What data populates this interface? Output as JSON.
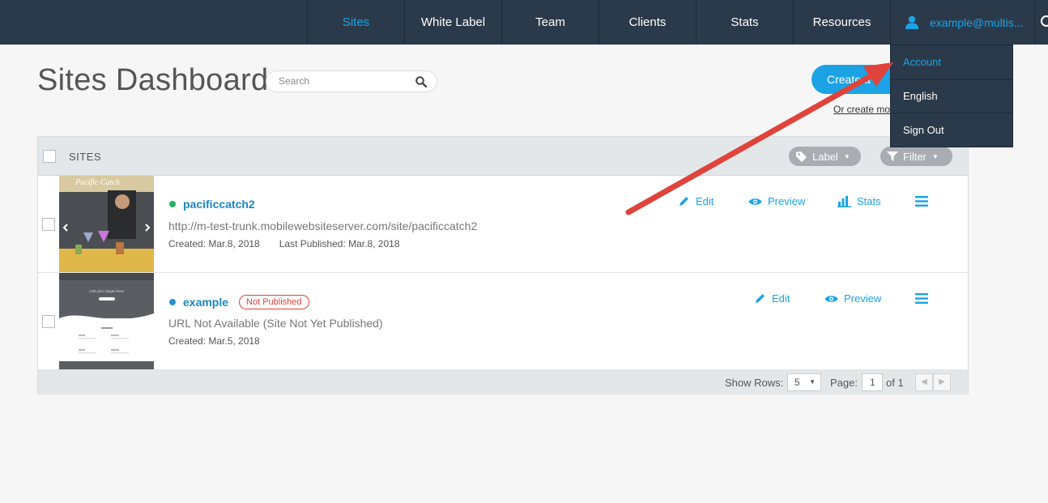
{
  "nav": {
    "items": [
      {
        "label": "Sites",
        "active": true
      },
      {
        "label": "White Label"
      },
      {
        "label": "Team"
      },
      {
        "label": "Clients"
      },
      {
        "label": "Stats"
      },
      {
        "label": "Resources"
      }
    ],
    "user": "example@multis..."
  },
  "dropdown": {
    "items": [
      "Account",
      "English",
      "Sign Out"
    ]
  },
  "page": {
    "title": "Sites Dashboard",
    "search_placeholder": "Search",
    "create_button": "Create a",
    "create_link": "Or create mo"
  },
  "table": {
    "header": "SITES",
    "label_button": "Label",
    "filter_button": "Filter",
    "sites": [
      {
        "name": "pacificcatch2",
        "status_color": "#27ae60",
        "url": "http://m-test-trunk.mobilewebsiteserver.com/site/pacificcatch2",
        "created": "Created: Mar.8, 2018",
        "published": "Last Published: Mar.8, 2018",
        "thumb_text": "Pacific Catch",
        "actions": {
          "edit": "Edit",
          "preview": "Preview",
          "stats": "Stats"
        }
      },
      {
        "name": "example",
        "status_color": "#2b8fd0",
        "badge": "Not Published",
        "url": "URL Not Available (Site Not Yet Published)",
        "created": "Created: Mar.5, 2018",
        "thumb_text": "Add your slogan here",
        "actions": {
          "edit": "Edit",
          "preview": "Preview"
        }
      }
    ],
    "footer": {
      "show_rows_label": "Show Rows:",
      "rows_value": "5",
      "page_label": "Page:",
      "page_value": "1",
      "of_label": "of 1"
    }
  },
  "colors": {
    "accent": "#1ba3e6",
    "nav_bg": "#2b3a4a",
    "arrow": "#e0433b"
  }
}
